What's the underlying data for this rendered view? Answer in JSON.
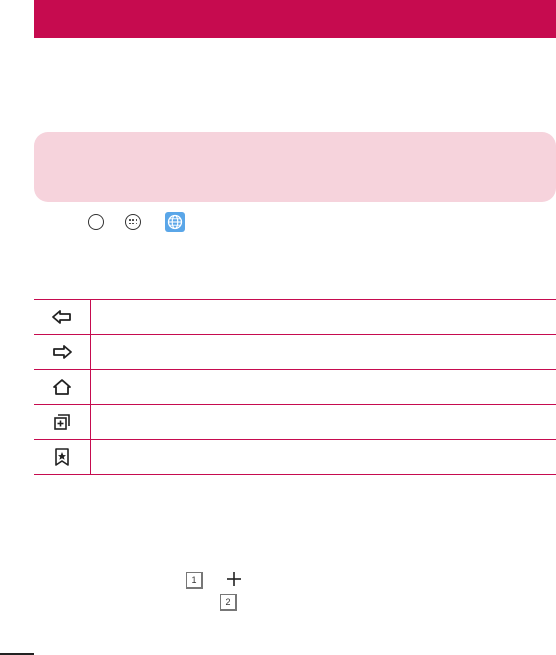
{
  "header": {
    "color": "#c60b4f"
  },
  "note": {
    "color": "#f6d3dc"
  },
  "icon_row": {
    "icons": [
      "home-circle-icon",
      "apps-icon",
      "browser-globe-icon"
    ]
  },
  "toolbar_table": {
    "rows": [
      {
        "icon": "back-arrow-icon",
        "label": ""
      },
      {
        "icon": "forward-arrow-icon",
        "label": ""
      },
      {
        "icon": "home-icon",
        "label": ""
      },
      {
        "icon": "windows-icon",
        "label": ""
      },
      {
        "icon": "bookmark-star-icon",
        "label": ""
      }
    ]
  },
  "tabs": {
    "tab_one": "1",
    "tab_two": "2"
  }
}
